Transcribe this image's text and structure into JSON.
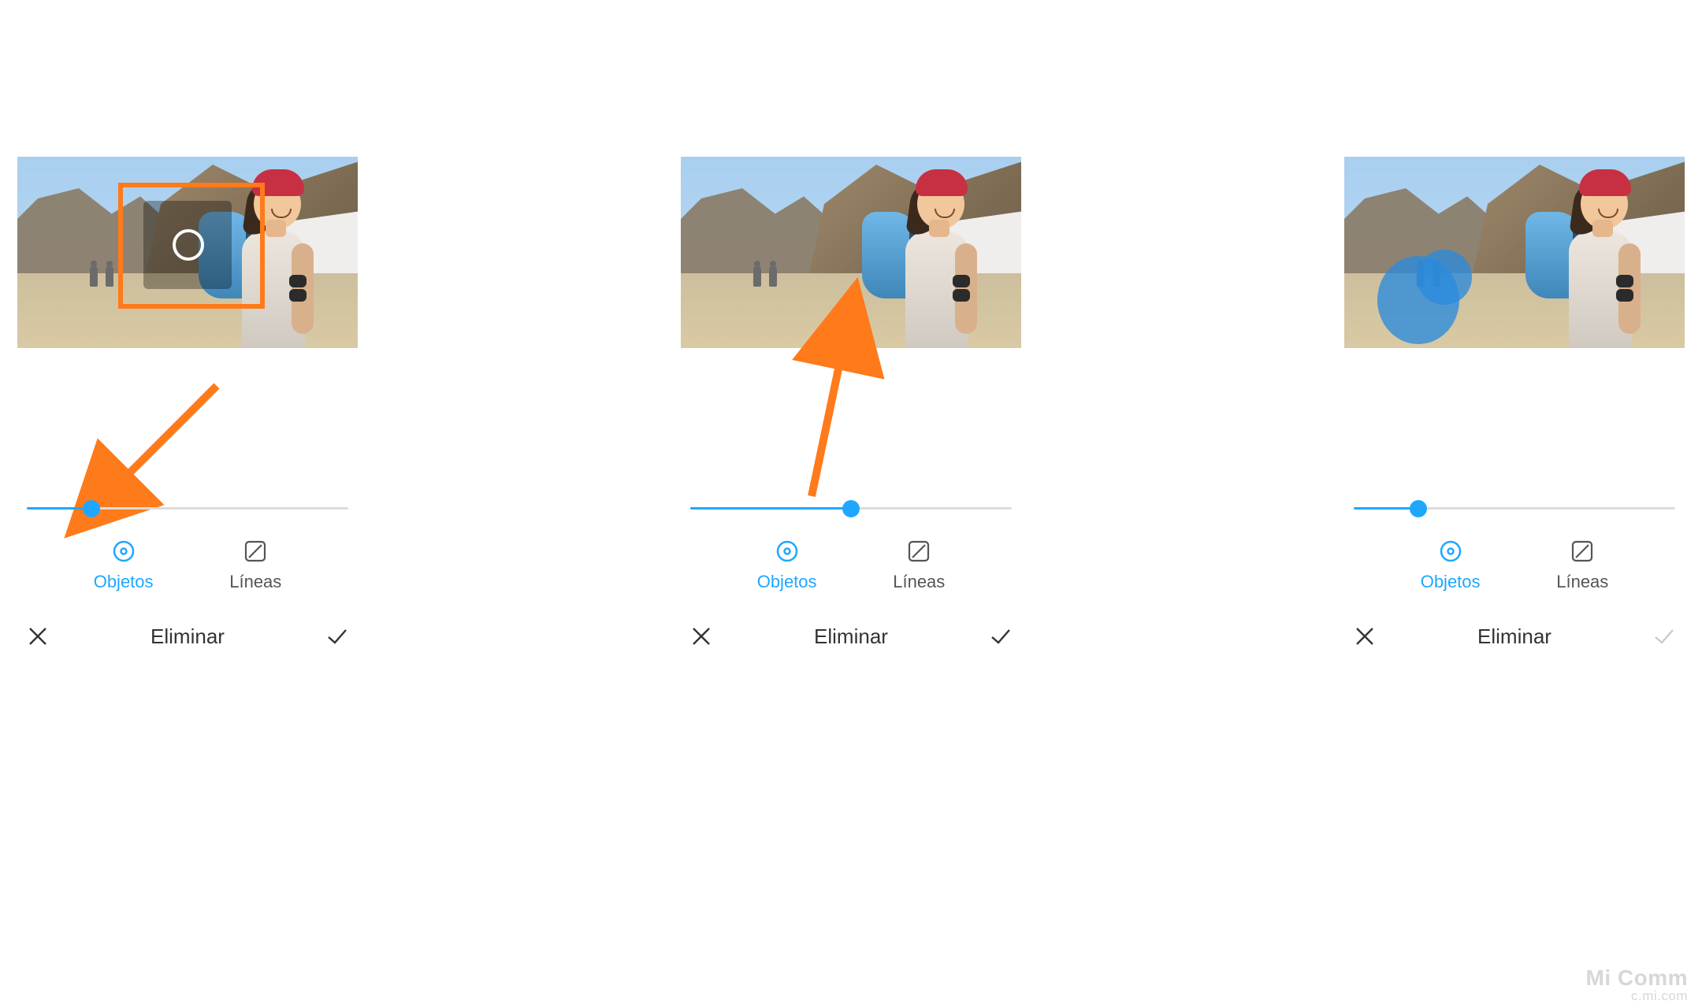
{
  "accent_color": "#1fa7ff",
  "highlight_color": "#ff7a1a",
  "panels": [
    {
      "slider_value": 20,
      "modes": {
        "objects_label": "Objetos",
        "lines_label": "Líneas",
        "active": "objects"
      },
      "footer": {
        "title": "Eliminar",
        "confirm_enabled": true
      },
      "overlay": "selection"
    },
    {
      "slider_value": 50,
      "modes": {
        "objects_label": "Objetos",
        "lines_label": "Líneas",
        "active": "objects"
      },
      "footer": {
        "title": "Eliminar",
        "confirm_enabled": true
      },
      "overlay": "none"
    },
    {
      "slider_value": 20,
      "modes": {
        "objects_label": "Objetos",
        "lines_label": "Líneas",
        "active": "objects"
      },
      "footer": {
        "title": "Eliminar",
        "confirm_enabled": false
      },
      "overlay": "brush"
    }
  ],
  "watermark": {
    "line1": "Mi Comm",
    "line2": "c.mi.com"
  }
}
